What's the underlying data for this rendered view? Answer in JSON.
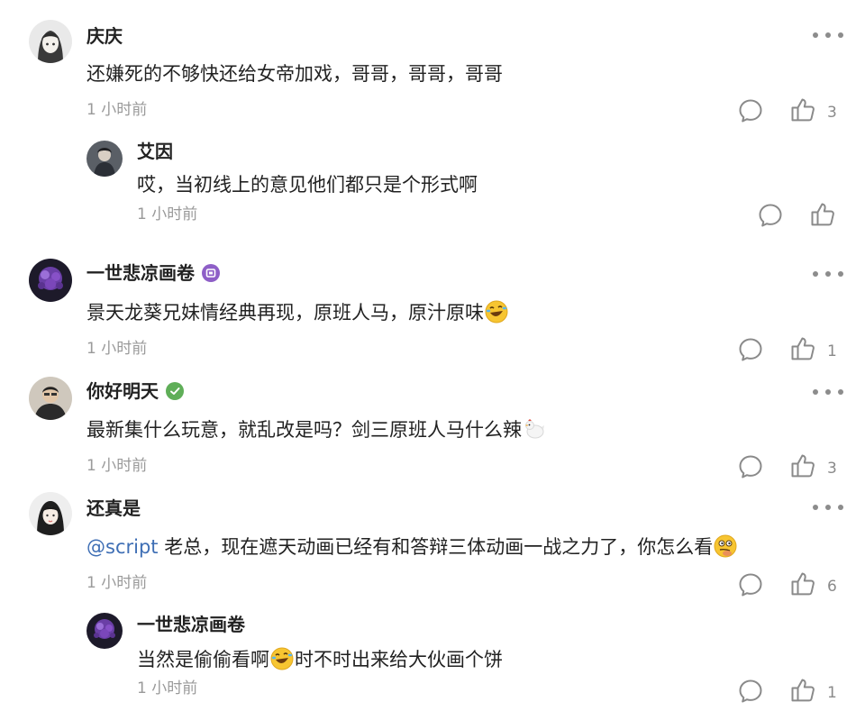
{
  "comments": [
    {
      "name": "庆庆",
      "text": "还嫌死的不够快还给女帝加戏，哥哥，哥哥，哥哥",
      "time": "1 小时前",
      "likes": "3",
      "avatar_icon": "anime-girl-avatar"
    },
    {
      "name": "艾因",
      "text": "哎，当初线上的意见他们都只是个形式啊",
      "time": "1 小时前",
      "likes": "",
      "avatar_icon": "character-avatar"
    },
    {
      "name": "一世悲凉画卷",
      "text": "景天龙葵兄妹情经典再现，原班人马，原汁原味",
      "time": "1 小时前",
      "likes": "1",
      "badge_color": "#8e5fc7",
      "emoji": "rofl-emoji",
      "avatar_icon": "purple-flower-avatar"
    },
    {
      "name": "你好明天",
      "text": "最新集什么玩意，就乱改是吗？剑三原班人马什么辣",
      "time": "1 小时前",
      "likes": "3",
      "badge_color": "#5fae58",
      "emoji": "chicken-emoji",
      "avatar_icon": "man-avatar"
    },
    {
      "name": "还真是",
      "mention": "@script",
      "text": " 老总，现在遮天动画已经有和答辩三体动画一战之力了，你怎么看",
      "time": "1 小时前",
      "likes": "6",
      "emoji": "thinking-emoji",
      "avatar_icon": "girl-avatar"
    },
    {
      "name": "一世悲凉画卷",
      "text_before": "当然是偷偷看啊",
      "text_after": "时不时出来给大伙画个饼",
      "time": "1 小时前",
      "likes": "1",
      "emoji": "rofl-emoji",
      "avatar_icon": "purple-flower-avatar"
    }
  ],
  "colors": {
    "mention": "#3f6fb5",
    "icon": "#8a8a8a",
    "time": "#9a9a9a"
  }
}
